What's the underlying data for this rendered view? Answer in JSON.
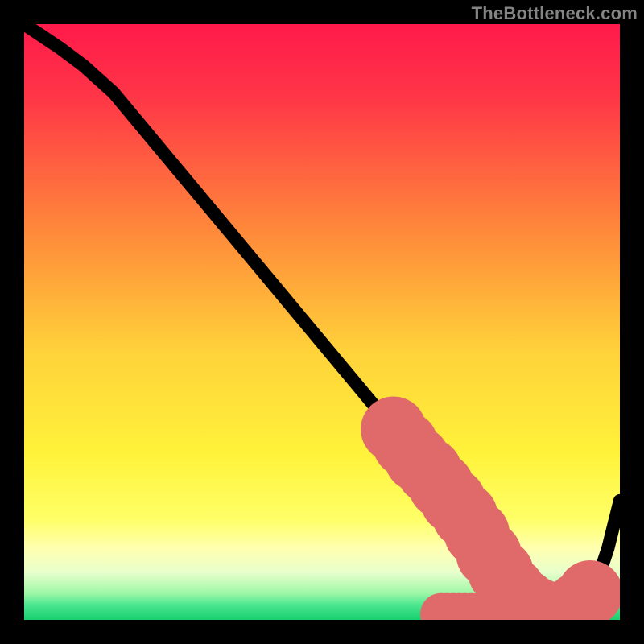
{
  "watermark": "TheBottleneck.com",
  "colors": {
    "bg": "#000000",
    "watermark_text": "#848484",
    "curve_stroke": "#000000",
    "marker_fill": "#e06a6a",
    "gradient_stops": [
      {
        "offset": 0.0,
        "color": "#ff1a4b"
      },
      {
        "offset": 0.12,
        "color": "#ff3547"
      },
      {
        "offset": 0.35,
        "color": "#ff8a3a"
      },
      {
        "offset": 0.55,
        "color": "#ffd23a"
      },
      {
        "offset": 0.72,
        "color": "#fff23a"
      },
      {
        "offset": 0.83,
        "color": "#ffff66"
      },
      {
        "offset": 0.88,
        "color": "#ffffb0"
      },
      {
        "offset": 0.92,
        "color": "#e8ffcc"
      },
      {
        "offset": 0.955,
        "color": "#9ff7a8"
      },
      {
        "offset": 0.975,
        "color": "#4be68f"
      },
      {
        "offset": 1.0,
        "color": "#18cf6e"
      }
    ]
  },
  "chart_data": {
    "type": "line",
    "title": "",
    "xlabel": "",
    "ylabel": "",
    "xlim": [
      0,
      100
    ],
    "ylim": [
      0,
      100
    ],
    "grid": false,
    "legend": false,
    "series": [
      {
        "name": "bottleneck-curve",
        "x": [
          0,
          3,
          6,
          10,
          15,
          20,
          25,
          30,
          35,
          40,
          45,
          50,
          55,
          60,
          62,
          65,
          68,
          70,
          72,
          74,
          76,
          78,
          80,
          82,
          84,
          86,
          88,
          90,
          92,
          94,
          96,
          98,
          100
        ],
        "y": [
          100,
          98,
          96,
          93,
          88.5,
          82.5,
          76.5,
          70.5,
          64.5,
          58.5,
          52.5,
          46.5,
          40.5,
          34.5,
          32,
          28.5,
          25,
          22.5,
          20,
          17.5,
          14.5,
          11,
          8,
          5,
          3,
          1.7,
          1,
          1,
          1.5,
          3,
          6,
          12,
          20
        ]
      }
    ],
    "markers": [
      {
        "name": "cluster-dots",
        "size": "big",
        "points_x": [
          62,
          64,
          66,
          68,
          70,
          72,
          74,
          76,
          78,
          80,
          82,
          84,
          86,
          88,
          90,
          93,
          95
        ],
        "points_y": [
          32,
          29.5,
          27,
          25,
          22.5,
          20,
          17.5,
          14.5,
          11,
          8,
          5,
          3,
          1.7,
          1,
          1,
          2.5,
          4.5
        ]
      },
      {
        "name": "flat-bottom-dots",
        "size": "small",
        "points_x": [
          70,
          71,
          72,
          73,
          74,
          75,
          76,
          77,
          78,
          79,
          80,
          81,
          82,
          83,
          84,
          85,
          86,
          87,
          88,
          89,
          90
        ],
        "points_y": [
          1,
          1,
          1,
          1,
          1,
          1,
          1,
          1,
          1,
          1,
          1,
          1,
          1,
          1,
          1,
          1,
          1,
          1,
          1,
          1,
          1
        ]
      }
    ]
  }
}
